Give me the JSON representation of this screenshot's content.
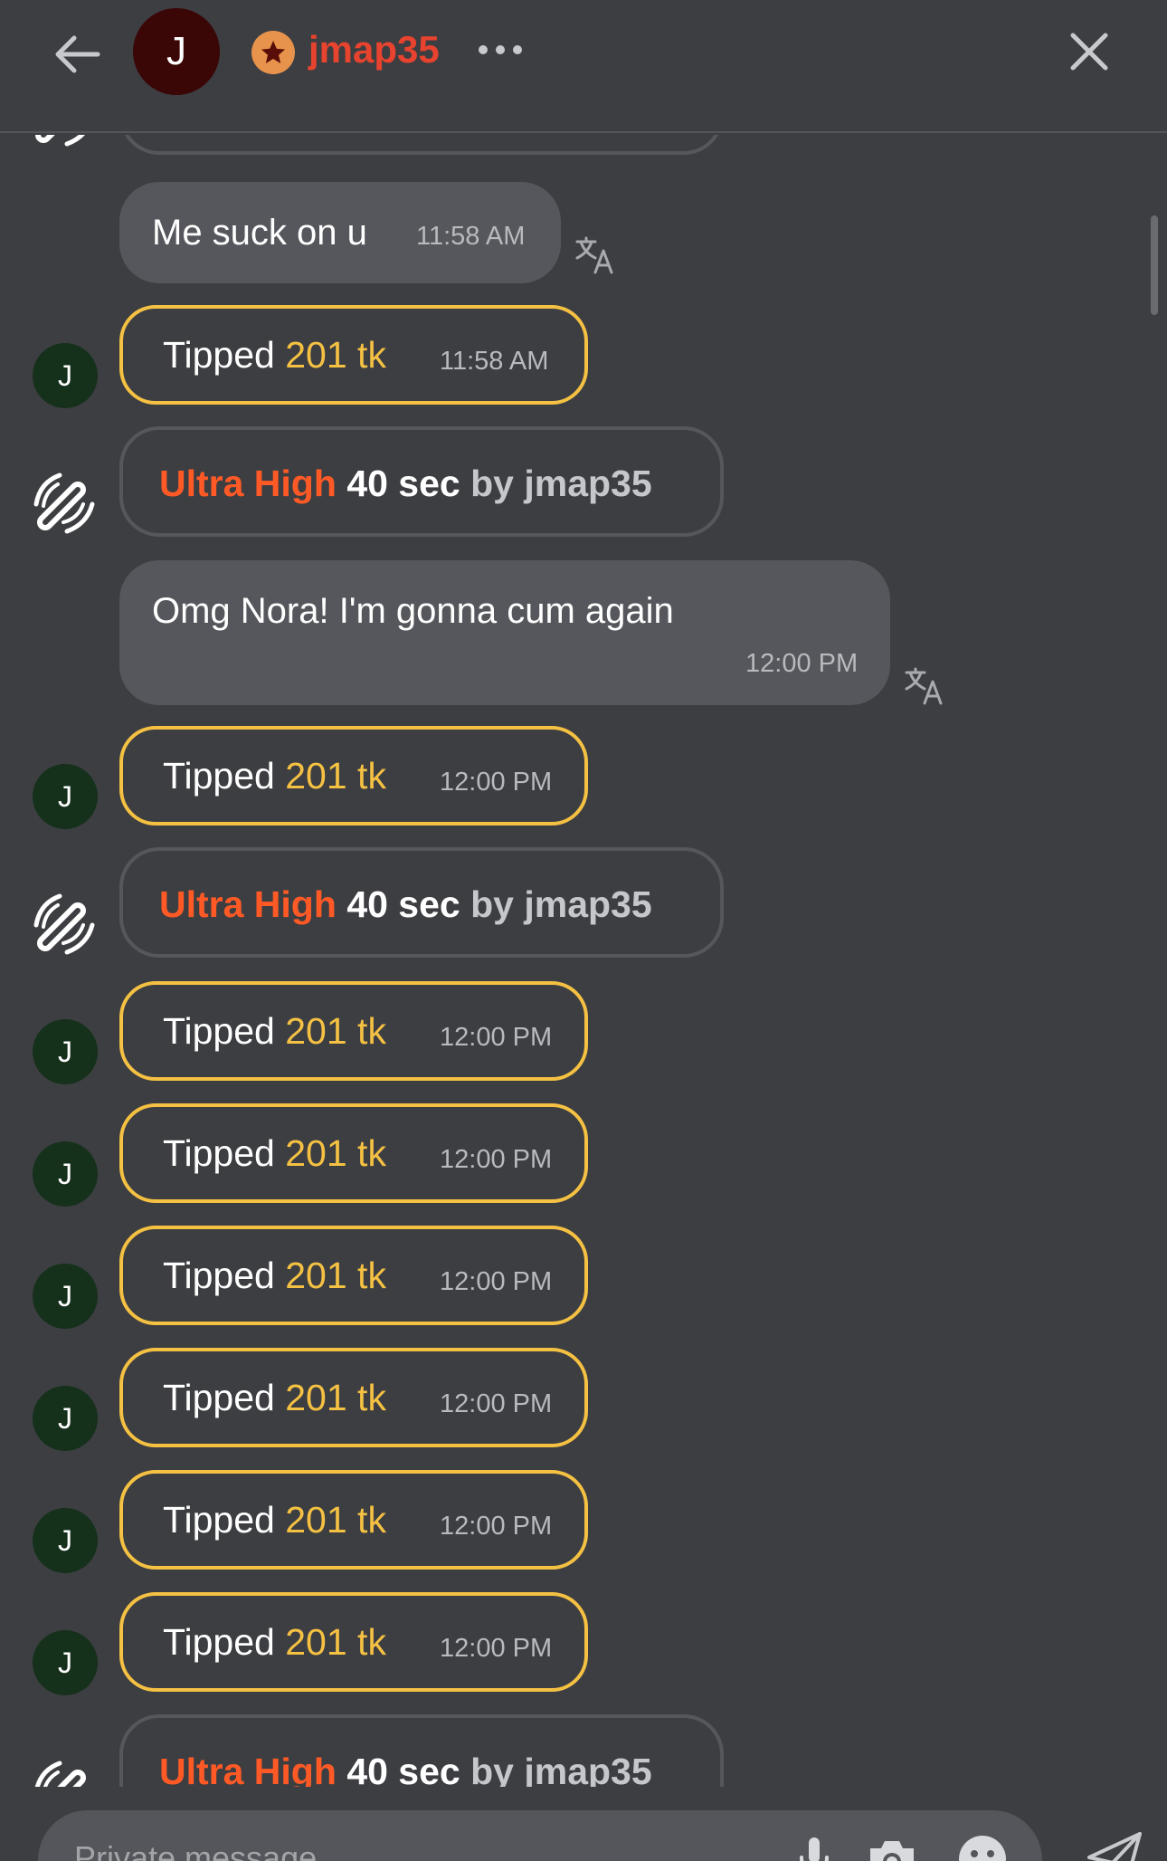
{
  "header": {
    "avatar_initial": "J",
    "username": "jmap35"
  },
  "messages": {
    "m1": {
      "text": "Me suck on u",
      "time": "11:58 AM"
    },
    "m2": {
      "text": "Omg Nora! I'm gonna cum again",
      "time": "12:00 PM"
    }
  },
  "tips": [
    {
      "avatar": "J",
      "word": "Tipped",
      "amount": "201 tk",
      "time": "11:58 AM"
    },
    {
      "avatar": "J",
      "word": "Tipped",
      "amount": "201 tk",
      "time": "12:00 PM"
    },
    {
      "avatar": "J",
      "word": "Tipped",
      "amount": "201 tk",
      "time": "12:00 PM"
    },
    {
      "avatar": "J",
      "word": "Tipped",
      "amount": "201 tk",
      "time": "12:00 PM"
    },
    {
      "avatar": "J",
      "word": "Tipped",
      "amount": "201 tk",
      "time": "12:00 PM"
    },
    {
      "avatar": "J",
      "word": "Tipped",
      "amount": "201 tk",
      "time": "12:00 PM"
    },
    {
      "avatar": "J",
      "word": "Tipped",
      "amount": "201 tk",
      "time": "12:00 PM"
    },
    {
      "avatar": "J",
      "word": "Tipped",
      "amount": "201 tk",
      "time": "12:00 PM"
    }
  ],
  "system": [
    {
      "level": "Ultra High",
      "duration": "40 sec",
      "by": "by jmap35"
    },
    {
      "level": "Ultra High",
      "duration": "40 sec",
      "by": "by jmap35"
    },
    {
      "level": "Ultra High",
      "duration": "40 sec",
      "by": "by jmap35"
    }
  ],
  "composer": {
    "placeholder": "Private message"
  },
  "colors": {
    "background": "#3d3e42",
    "bubble": "#56575c",
    "tip_border": "#f5c143",
    "username": "#e8432e",
    "level": "#ff5a26",
    "avatar_bg": "#15301b"
  },
  "icons": {
    "back": "arrow-left-icon",
    "star": "star-icon",
    "more": "more-horizontal-icon",
    "close": "close-icon",
    "toy": "vibration-toy-icon",
    "translate": "translate-icon",
    "mic": "microphone-icon",
    "camera": "camera-icon",
    "emoji": "emoji-icon",
    "send": "send-icon"
  }
}
